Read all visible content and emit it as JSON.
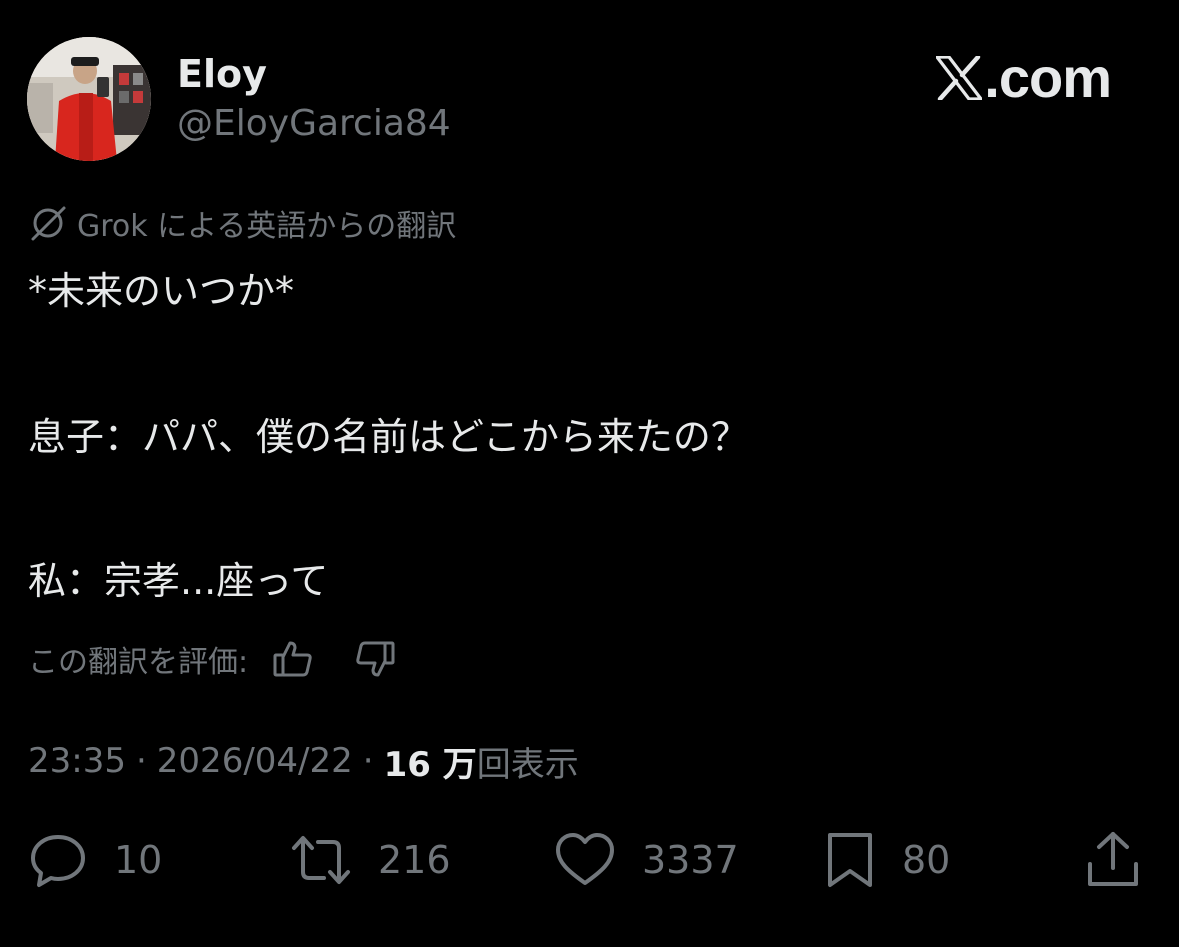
{
  "author": {
    "display_name": "Eloy",
    "handle": "@EloyGarcia84"
  },
  "brand": {
    "text": ".com"
  },
  "translation_note": {
    "text": "Grok による英語からの翻訳"
  },
  "tweet": {
    "lines": [
      "*未来のいつか*",
      "息子：パパ、僕の名前はどこから来たの？",
      "私：宗孝...座って"
    ]
  },
  "rating": {
    "label": "この翻訳を評価:"
  },
  "meta": {
    "time": "23:35",
    "separator": "·",
    "date": "2026/04/22",
    "views_count": "16 万",
    "views_label": "回表示"
  },
  "actions": {
    "replies": "10",
    "reposts": "216",
    "likes": "3337",
    "bookmarks": "80"
  },
  "colors": {
    "background": "#000000",
    "primary_text": "#e7e9ea",
    "secondary_text": "#71767b"
  },
  "icons": {
    "logo": "x-logo-icon",
    "grok": "grok-icon",
    "rate_up": "thumbs-up-icon",
    "rate_down": "thumbs-down-icon",
    "reply": "reply-icon",
    "repost": "repost-icon",
    "like": "heart-icon",
    "bookmark": "bookmark-icon",
    "share": "share-icon"
  }
}
